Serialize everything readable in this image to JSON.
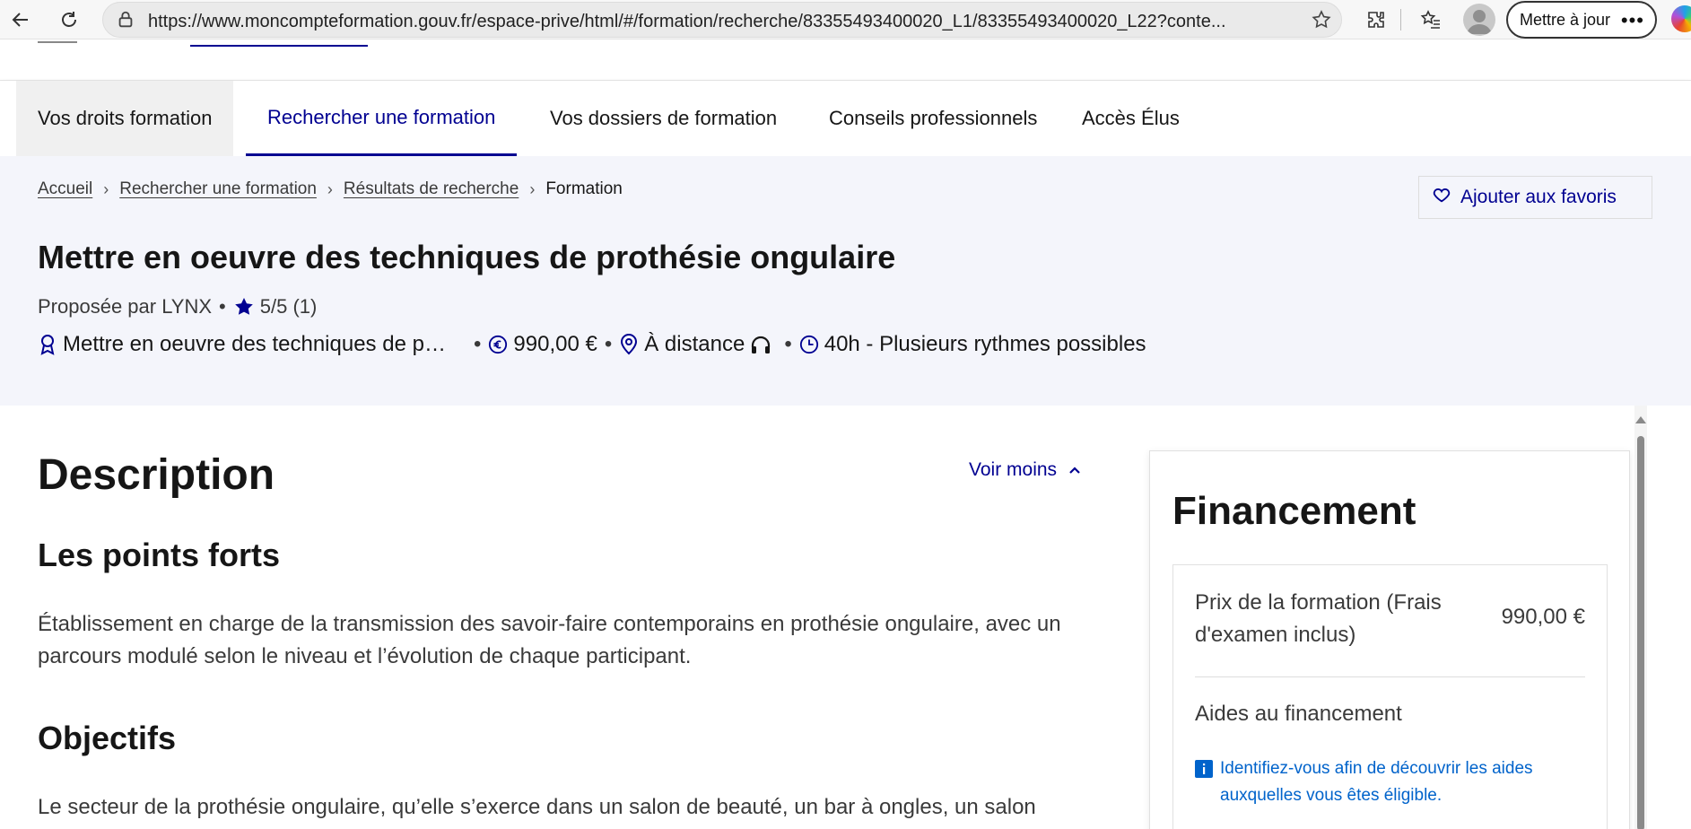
{
  "browser": {
    "url": "https://www.moncompteformation.gouv.fr/espace-prive/html/#/formation/recherche/83355493400020_L1/83355493400020_L22?conte...",
    "update_label": "Mettre à jour",
    "more_label": "•••"
  },
  "nav": {
    "items": [
      {
        "label": "Vos droits formation"
      },
      {
        "label": "Rechercher une formation"
      },
      {
        "label": "Vos dossiers de formation"
      },
      {
        "label": "Conseils professionnels"
      },
      {
        "label": "Accès Élus"
      }
    ],
    "active_index": 1
  },
  "breadcrumb": {
    "items": [
      "Accueil",
      "Rechercher une formation",
      "Résultats de recherche"
    ],
    "current": "Formation"
  },
  "favorite_label": "Ajouter aux favoris",
  "training": {
    "title": "Mettre en oeuvre des techniques de prothésie ongulaire",
    "provider": "Proposée par LYNX",
    "rating": "5/5 (1)",
    "certification": "Mettre en oeuvre des techniques de prothésie ongulaire",
    "price": "990,00 €",
    "mode": "À distance",
    "duration": "40h - Plusieurs rythmes possibles"
  },
  "description": {
    "title": "Description",
    "toggle_label": "Voir moins",
    "strengths_title": "Les points forts",
    "strengths_text": "Établissement en charge de la transmission des savoir-faire contemporains en prothésie ongulaire, avec un parcours modulé selon le niveau et l’évolution de chaque participant.",
    "objectives_title": "Objectifs",
    "objectives_text": "Le secteur de la prothésie ongulaire, qu’elle s’exerce dans un salon de beauté, un bar à ongles, un salon"
  },
  "funding": {
    "title": "Financement",
    "price_label": "Prix de la formation (Frais d'examen inclus)",
    "price_value": "990,00 €",
    "aid_title": "Aides au financement",
    "aid_info": "Identifiez-vous afin de découvrir les aides auxquelles vous êtes éligible."
  },
  "colors": {
    "accent": "#000091",
    "hero_bg": "#f4f5fb",
    "info_link": "#0063cb"
  }
}
